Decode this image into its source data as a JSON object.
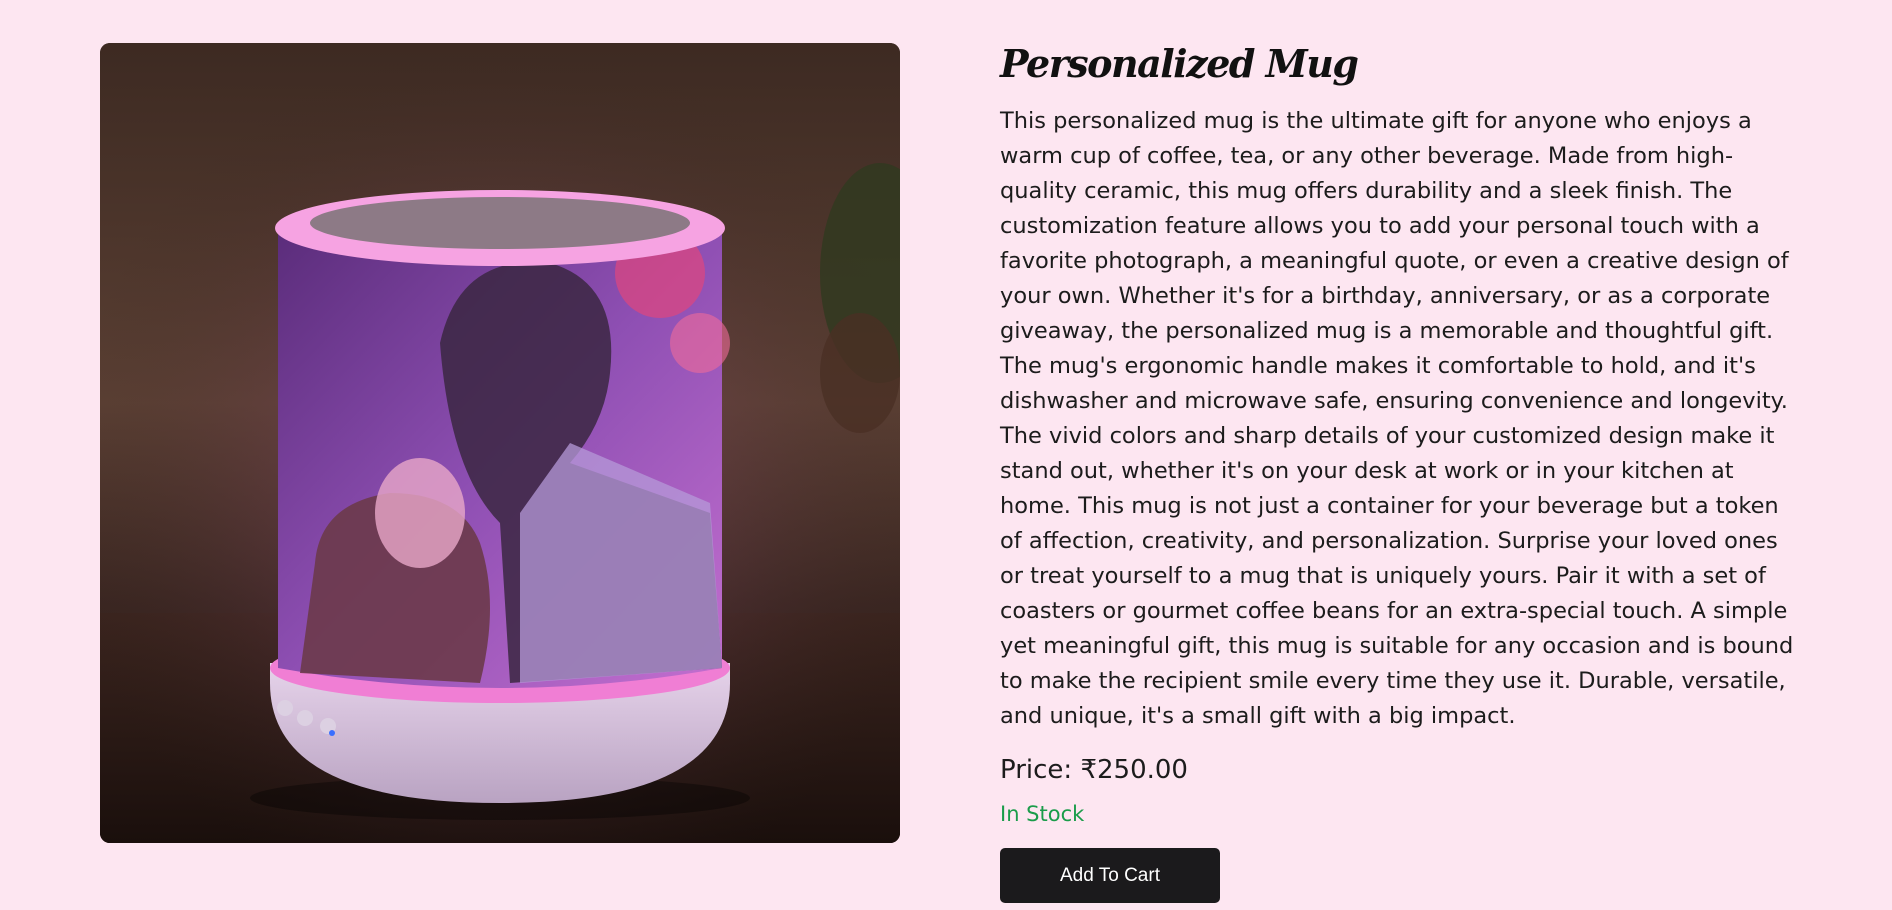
{
  "product": {
    "title": "Personalized Mug",
    "image_alt": "Personalized photo mug glowing pink",
    "description": "This personalized mug is the ultimate gift for anyone who enjoys a warm cup of coffee, tea, or any other beverage. Made from high-quality ceramic, this mug offers durability and a sleek finish. The customization feature allows you to add your personal touch with a favorite photograph, a meaningful quote, or even a creative design of your own. Whether it's for a birthday, anniversary, or as a corporate giveaway, the personalized mug is a memorable and thoughtful gift. The mug's ergonomic handle makes it comfortable to hold, and it's dishwasher and microwave safe, ensuring convenience and longevity. The vivid colors and sharp details of your customized design make it stand out, whether it's on your desk at work or in your kitchen at home. This mug is not just a container for your beverage but a token of affection, creativity, and personalization. Surprise your loved ones or treat yourself to a mug that is uniquely yours. Pair it with a set of coasters or gourmet coffee beans for an extra-special touch. A simple yet meaningful gift, this mug is suitable for any occasion and is bound to make the recipient smile every time they use it. Durable, versatile, and unique, it's a small gift with a big impact.",
    "price_text": "Price: ₹250.00",
    "stock_status": "In Stock",
    "add_to_cart_label": "Add To Cart"
  },
  "colors": {
    "page_background": "#fde6f1",
    "in_stock": "#1a9c4a",
    "button_background": "#1b1a1c"
  }
}
